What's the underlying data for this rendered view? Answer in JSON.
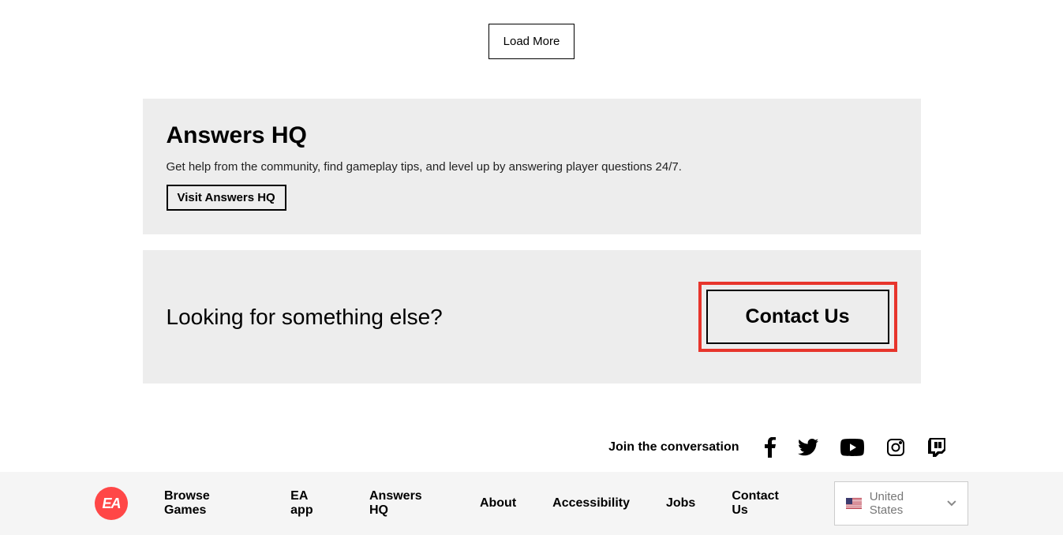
{
  "loadMore": {
    "label": "Load More"
  },
  "answersPanel": {
    "title": "Answers HQ",
    "description": "Get help from the community, find gameplay tips, and level up by answering player questions 24/7.",
    "buttonLabel": "Visit Answers HQ"
  },
  "contactPanel": {
    "title": "Looking for something else?",
    "buttonLabel": "Contact Us"
  },
  "social": {
    "label": "Join the conversation"
  },
  "footer": {
    "links": {
      "browseGames": "Browse Games",
      "eaApp": "EA app",
      "answersHq": "Answers HQ",
      "about": "About",
      "accessibility": "Accessibility",
      "jobs": "Jobs",
      "contactUs": "Contact Us"
    },
    "country": "United States",
    "logoText": "EA"
  }
}
